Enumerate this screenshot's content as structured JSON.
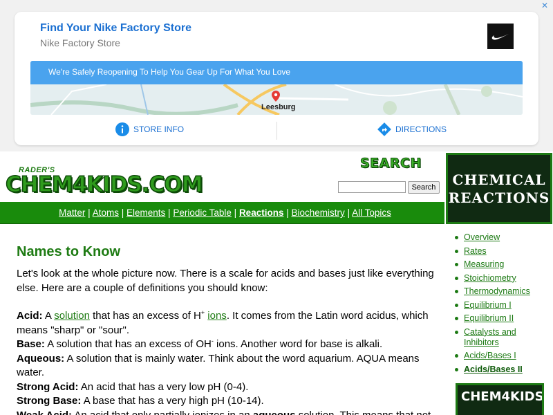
{
  "ad": {
    "title": "Find Your Nike Factory Store",
    "subtitle": "Nike Factory Store",
    "banner_text": "We're Safely Reopening To Help You Gear Up For What You Love",
    "city": "Leesburg",
    "store_info": "STORE INFO",
    "directions": "DIRECTIONS",
    "close_glyph": "✕",
    "accent": "#1a6fd1"
  },
  "header": {
    "logo_small": "RADER'S",
    "logo_main": "CHEM4KIDS.COM",
    "search_logo": "SEARCH",
    "search_value": "",
    "search_button": "Search"
  },
  "nav": {
    "items": [
      "Matter",
      "Atoms",
      "Elements",
      "Periodic Table",
      "Reactions",
      "Biochemistry",
      "All Topics"
    ],
    "separator": "|"
  },
  "sidebar": {
    "banner_line1": "CHEMICAL",
    "banner_line2": "REACTIONS",
    "items": [
      "Overview",
      "Rates",
      "Measuring",
      "Stoichiometry",
      "Thermodynamics",
      "Equilibrium I",
      "Equilibrium II",
      "Catalysts and Inhibitors",
      "Acids/Bases I",
      "Acids/Bases II"
    ],
    "quiz_text": "CHEM4KIDS"
  },
  "content": {
    "title": "Names to Know",
    "intro": "Let's look at the whole picture now. There is a scale for acids and bases just like everything else. Here are a couple of definitions you should know:",
    "acid_term": "Acid:",
    "acid_a": "A",
    "acid_link1": "solution",
    "acid_mid": "that has an excess of H",
    "acid_sup": "+",
    "acid_link2": "ions",
    "acid_rest": ". It comes from the Latin word acidus, which means \"sharp\" or \"sour\".",
    "base_term": "Base:",
    "base_mid": "A solution that has an excess of OH",
    "base_sup": "-",
    "base_rest": "ions. Another word for base is alkali.",
    "aqueous_term": "Aqueous:",
    "aqueous_def": "A solution that is mainly water. Think about the word aquarium. AQUA means water.",
    "strong_acid_term": "Strong Acid:",
    "strong_acid_def": "An acid that has a very low pH (0-4).",
    "strong_base_term": "Strong Base:",
    "strong_base_def": "A base that has a very high pH (10-14).",
    "weak_acid_term": "Weak Acid:",
    "weak_acid_def1": "An acid that only partially ionizes in an",
    "weak_acid_bold": "aqueous",
    "weak_acid_def2": "solution. This means that not"
  },
  "colors": {
    "nav_green": "#198b0c",
    "title_green": "#1e7b13",
    "chalkboard": "#102a12"
  }
}
